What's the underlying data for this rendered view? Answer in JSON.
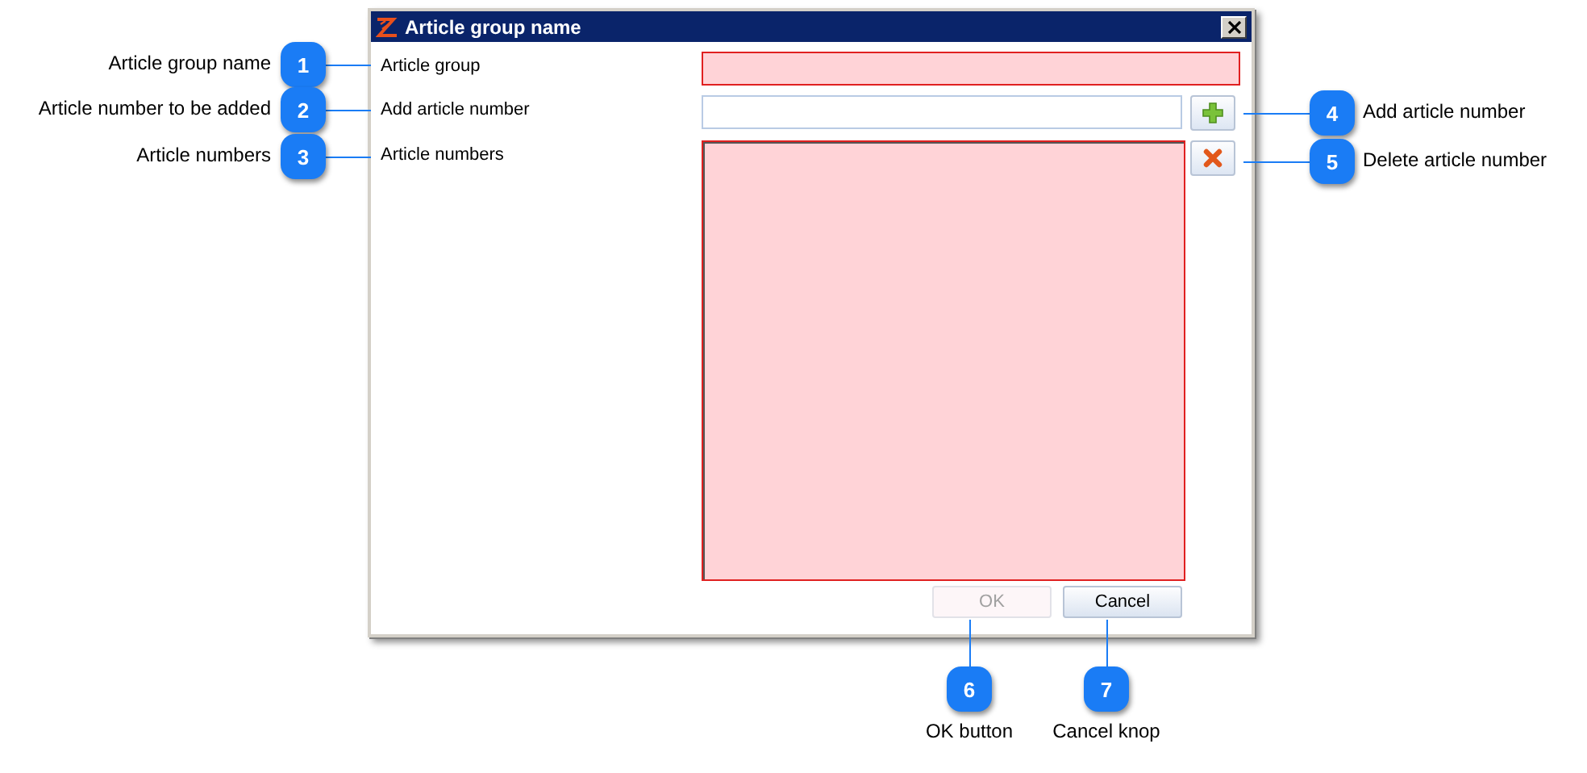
{
  "window": {
    "title": "Article group name"
  },
  "fields": [
    {
      "label": "Article group",
      "kind": "text",
      "invalid": true
    },
    {
      "label": "Add article number",
      "kind": "text",
      "invalid": false,
      "button": {
        "kind": "add"
      }
    },
    {
      "label": "Article numbers",
      "kind": "list",
      "invalid": true,
      "button": {
        "kind": "delete"
      }
    }
  ],
  "buttons": [
    {
      "label": "OK",
      "disabled": true
    },
    {
      "label": "Cancel",
      "disabled": false
    }
  ],
  "callouts": [
    {
      "number": "1",
      "text": "Article group name",
      "kind": "left"
    },
    {
      "number": "2",
      "text": "Article number to be added",
      "kind": "left"
    },
    {
      "number": "3",
      "text": "Article numbers",
      "kind": "left"
    },
    {
      "number": "4",
      "text": "Add article number",
      "kind": "right"
    },
    {
      "number": "5",
      "text": "Delete article number",
      "kind": "right"
    },
    {
      "number": "6",
      "text": "OK button",
      "kind": "bottom"
    },
    {
      "number": "7",
      "text": "Cancel knop",
      "kind": "bottom"
    }
  ]
}
